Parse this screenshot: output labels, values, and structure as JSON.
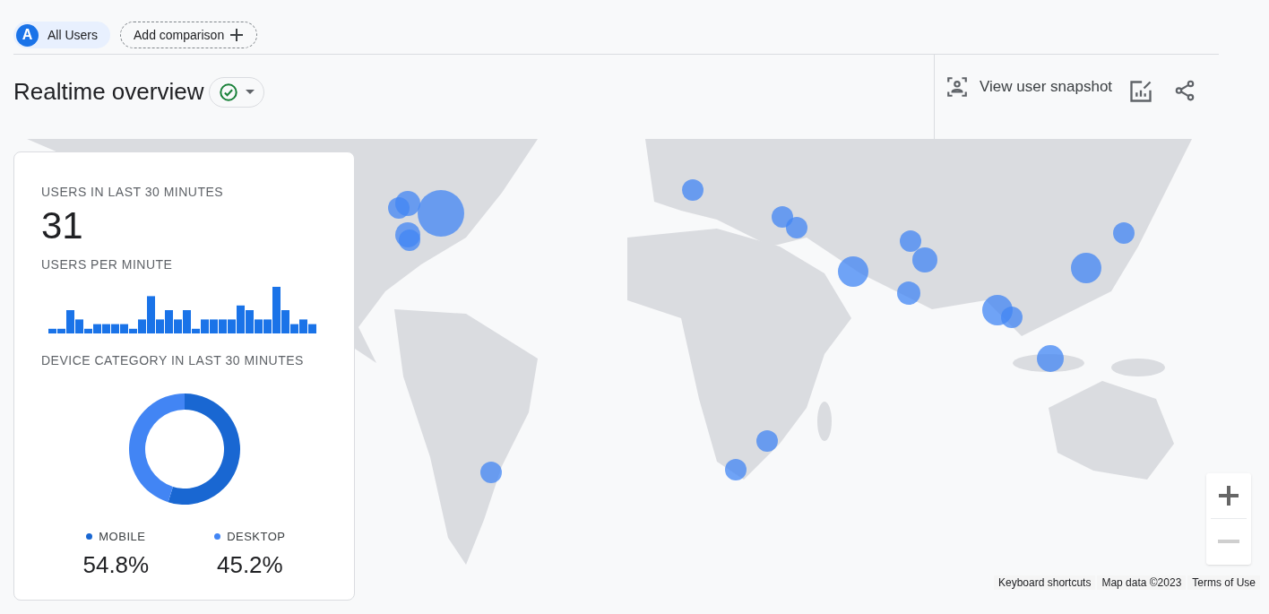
{
  "comparisons": {
    "segment": {
      "badge": "A",
      "label": "All Users"
    },
    "add_button": "Add comparison"
  },
  "header": {
    "title": "Realtime overview",
    "actions": [
      {
        "kind": "snapshot",
        "label": "View user snapshot"
      },
      {
        "kind": "customize"
      },
      {
        "kind": "share"
      }
    ]
  },
  "card": {
    "users_title": "USERS IN LAST 30 MINUTES",
    "users_value": "31",
    "per_minute_title": "USERS PER MINUTE",
    "device_title": "DEVICE CATEGORY IN LAST 30 MINUTES",
    "chart_data": {
      "type": "donut",
      "categories": [
        "MOBILE",
        "DESKTOP"
      ],
      "values": [
        54.8,
        45.2
      ]
    },
    "legend": [
      {
        "value": "54.8%",
        "color": "#1967d2"
      },
      {
        "value": "45.2%",
        "color": "#4285f4"
      }
    ]
  },
  "map": {
    "zoom_controls": [
      {
        "kind": "plus",
        "disabled": false
      },
      {
        "kind": "minus",
        "disabled": true
      }
    ],
    "footer_links": [
      "Keyboard shortcuts",
      "Map data ©2023",
      "Terms of Use"
    ]
  }
}
